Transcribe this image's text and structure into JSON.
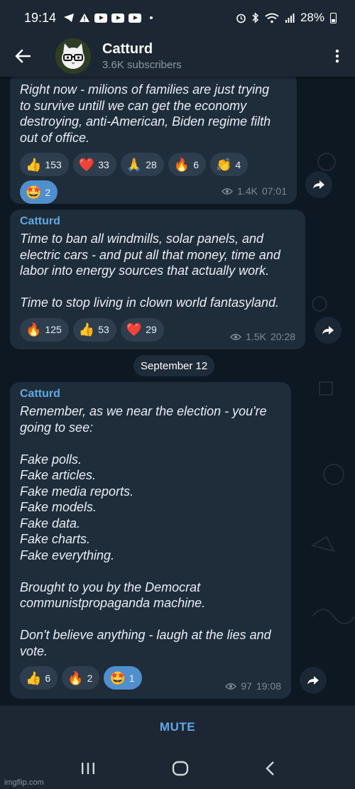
{
  "status_bar": {
    "time": "19:14",
    "battery": "28%"
  },
  "header": {
    "title": "Catturd",
    "subtitle": "3.6K subscribers"
  },
  "messages": [
    {
      "text": "Right now - milions of families are just trying\nto survive untill we can get the economy\ndestroying, anti-American, Biden regime filth\nout of office.",
      "reactions": [
        {
          "emoji": "👍",
          "count": "153",
          "mine": false
        },
        {
          "emoji": "❤️",
          "count": "33",
          "mine": false
        },
        {
          "emoji": "🙏",
          "count": "28",
          "mine": false
        },
        {
          "emoji": "🔥",
          "count": "6",
          "mine": false
        },
        {
          "emoji": "👏",
          "count": "4",
          "mine": false
        },
        {
          "emoji": "🤩",
          "count": "2",
          "mine": true
        }
      ],
      "views": "1.4K",
      "time": "07:01"
    },
    {
      "sender": "Catturd",
      "text": "Time to ban all windmills, solar panels, and\nelectric cars - and put all that money, time and\nlabor into energy sources that actually work.\n\nTime to stop living in clown world fantasyland.",
      "reactions": [
        {
          "emoji": "🔥",
          "count": "125",
          "mine": false
        },
        {
          "emoji": "👍",
          "count": "53",
          "mine": false
        },
        {
          "emoji": "❤️",
          "count": "29",
          "mine": false
        }
      ],
      "views": "1.5K",
      "time": "20:28"
    },
    {
      "sender": "Catturd",
      "text": "Remember, as we near the election - you're\ngoing to see:\n\nFake polls.\nFake articles.\nFake media reports.\nFake models.\nFake data.\nFake charts.\nFake everything.\n\nBrought to you by the Democrat\ncommunistpropaganda machine.\n\nDon't believe anything - laugh at the lies and\nvote.",
      "reactions": [
        {
          "emoji": "👍",
          "count": "6",
          "mine": false
        },
        {
          "emoji": "🔥",
          "count": "2",
          "mine": false
        },
        {
          "emoji": "🤩",
          "count": "1",
          "mine": true
        }
      ],
      "views": "97",
      "time": "19:08"
    }
  ],
  "date_separator": "September 12",
  "bottom_action": "MUTE",
  "watermark": "imgflip.com",
  "colors": {
    "accent": "#5eabe3",
    "bubble": "#1f2c3a",
    "background": "#0e1823",
    "bar": "#1d2733"
  },
  "icons": [
    "back-arrow-icon",
    "more-vert-icon",
    "share-icon",
    "eye-icon",
    "recent-apps-icon",
    "home-icon",
    "nav-back-icon"
  ]
}
